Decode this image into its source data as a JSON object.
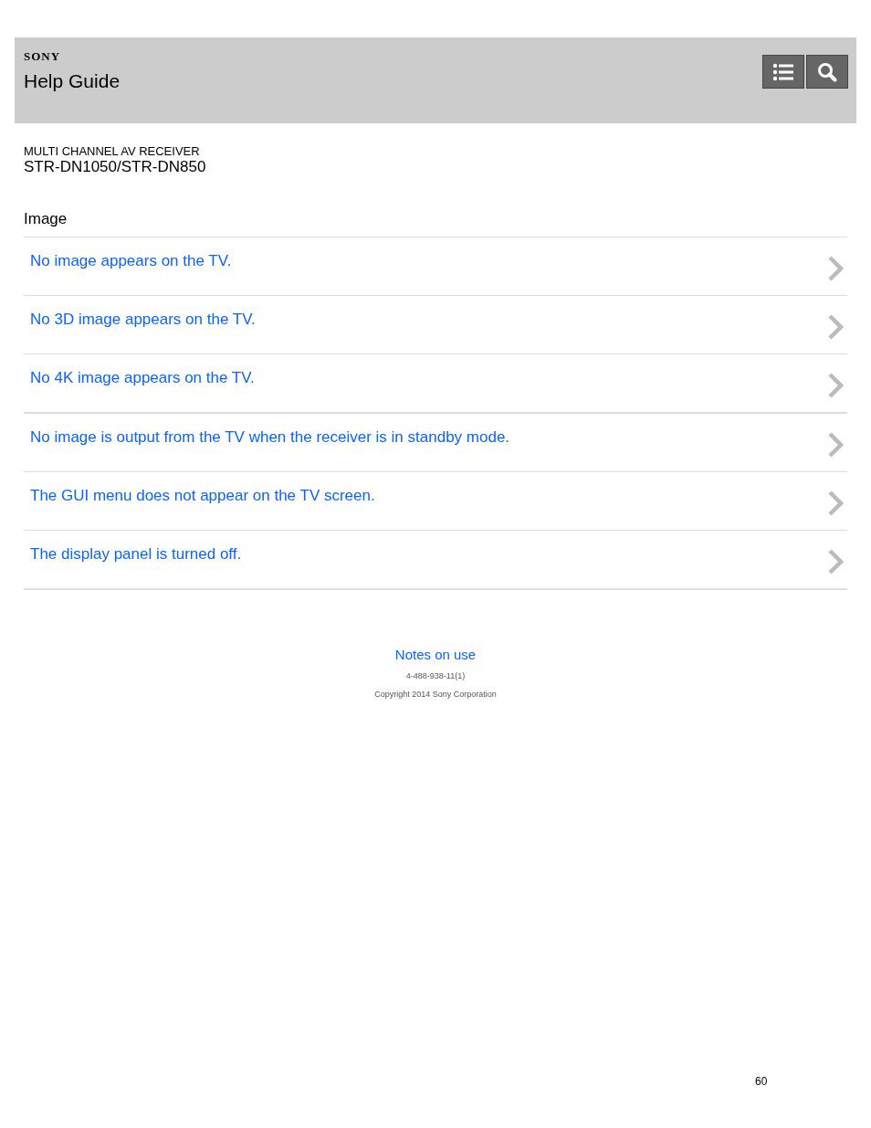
{
  "header": {
    "brand": "SONY",
    "title": "Help Guide"
  },
  "product": {
    "category": "MULTI CHANNEL AV RECEIVER",
    "model": "STR-DN1050/STR-DN850"
  },
  "section": {
    "title": "Image",
    "items": [
      {
        "label": "No image appears on the TV."
      },
      {
        "label": "No 3D image appears on the TV."
      },
      {
        "label": "No 4K image appears on the TV."
      },
      {
        "label": "No image is output from the TV when the receiver is in standby mode."
      },
      {
        "label": "The GUI menu does not appear on the TV screen."
      },
      {
        "label": "The display panel is turned off."
      }
    ]
  },
  "footer": {
    "link": "Notes on use",
    "code": "4-488-938-11(1)",
    "copyright": "Copyright 2014 Sony Corporation"
  },
  "page_number": "60"
}
